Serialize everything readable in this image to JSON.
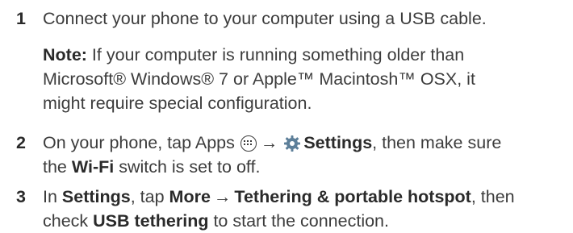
{
  "steps": [
    {
      "number": "1",
      "text": "Connect your phone to your computer using a USB cable.",
      "note": {
        "label": "Note:",
        "line1": " If your computer is running something older than",
        "line2": "Microsoft® Windows® 7 or Apple™ Macintosh™ OSX, it",
        "line3": "might require special configuration."
      }
    },
    {
      "number": "2",
      "line1_a": "On your phone, tap Apps ",
      "arrow": "→",
      "settings": "Settings",
      "line1_b": ", then make sure",
      "line2_a": "the ",
      "wifi": "Wi-Fi",
      "line2_b": " switch is set to off."
    },
    {
      "number": "3",
      "line1_a": "In ",
      "settings": "Settings",
      "line1_b": ", tap ",
      "more": "More",
      "arrow": "→",
      "tethering": "Tethering & portable hotspot",
      "line1_c": ", then",
      "line2_a": "check ",
      "usb": "USB tethering",
      "line2_b": " to start the connection."
    }
  ]
}
